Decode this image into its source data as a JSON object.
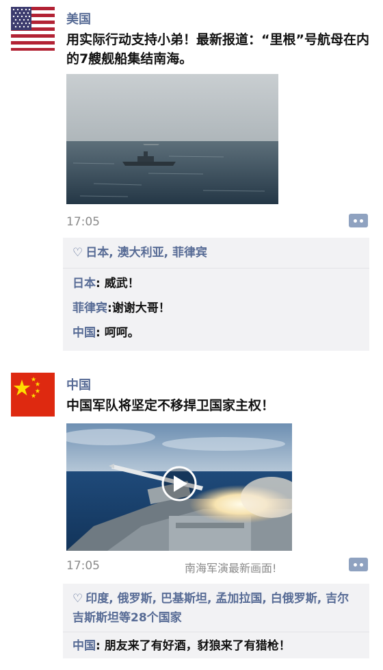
{
  "posts": [
    {
      "nickname": "美国",
      "text": "用实际行动支持小弟！最新报道：“里根”号航母在内的7艘舰船集结南海。",
      "time": "17:05",
      "likes": "日本, 澳大利亚, 菲律宾",
      "comments": [
        {
          "who": "日本",
          "sep": ": ",
          "text": "威武！"
        },
        {
          "who": "菲律宾",
          "sep": ":",
          "text": "谢谢大哥！"
        },
        {
          "who": "中国",
          "sep": ": ",
          "text": "呵呵。"
        }
      ]
    },
    {
      "nickname": "中国",
      "text": "中国军队将坚定不移捍卫国家主权！",
      "time": "17:05",
      "caption": "南海军演最新画面!",
      "likes": "印度, 俄罗斯, 巴基斯坦, 孟加拉国, 白俄罗斯, 吉尔吉斯斯坦等28个国家",
      "comments": [
        {
          "who": "中国",
          "sep": ": ",
          "text": "朋友来了有好酒，豺狼来了有猎枪！"
        }
      ]
    }
  ],
  "icons": {
    "like": "heart-outline",
    "more": "comment-more-dots",
    "play": "play-circle"
  }
}
